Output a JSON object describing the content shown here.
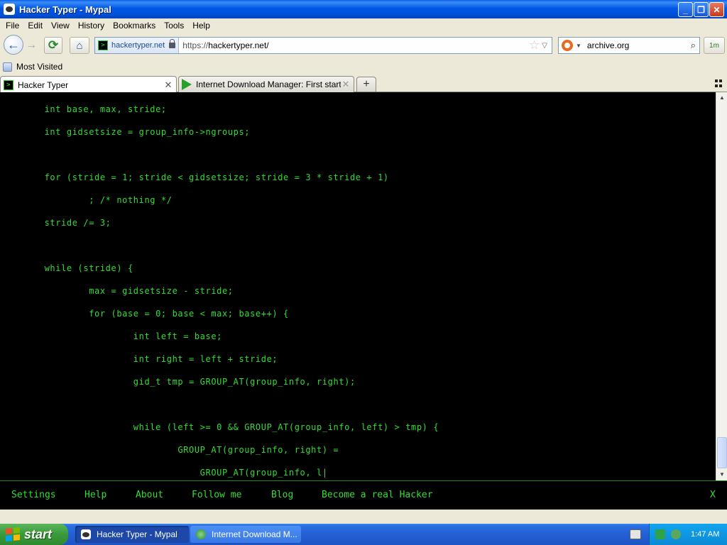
{
  "window": {
    "title": "Hacker Typer - Mypal",
    "controls": {
      "minimize": "_",
      "maximize": "❐",
      "close": "✕"
    }
  },
  "menubar": {
    "items": [
      {
        "label": "File"
      },
      {
        "label": "Edit"
      },
      {
        "label": "View"
      },
      {
        "label": "History"
      },
      {
        "label": "Bookmarks"
      },
      {
        "label": "Tools"
      },
      {
        "label": "Help"
      }
    ]
  },
  "navbar": {
    "back_icon": "←",
    "forward_icon": "→",
    "reload_icon": "⟳",
    "home_icon": "⌂",
    "site_identity": "hackertyper.net",
    "url_scheme": "https://",
    "url_rest": "hackertyper.net/",
    "bookmark_star": "☆",
    "dropdown_arrow": "▽",
    "search_value": "archive.org",
    "search_go_icon": "⌕",
    "idm_label": "1m"
  },
  "bookmarks": {
    "most_visited": "Most Visited"
  },
  "tabs": [
    {
      "label": "Hacker Typer",
      "close": "✕",
      "active": true
    },
    {
      "label": "Internet Download Manager: First start",
      "close": "✕",
      "active": false
    }
  ],
  "new_tab": "+",
  "code_lines": [
    "        int base, max, stride;",
    "        int gidsetsize = group_info->ngroups;",
    "",
    "        for (stride = 1; stride < gidsetsize; stride = 3 * stride + 1)",
    "                ; /* nothing */",
    "        stride /= 3;",
    "",
    "        while (stride) {",
    "                max = gidsetsize - stride;",
    "                for (base = 0; base < max; base++) {",
    "                        int left = base;",
    "                        int right = left + stride;",
    "                        gid_t tmp = GROUP_AT(group_info, right);",
    "",
    "                        while (left >= 0 && GROUP_AT(group_info, left) > tmp) {",
    "                                GROUP_AT(group_info, right) =",
    "                                    GROUP_AT(group_info, l|"
  ],
  "footer": {
    "settings": "Settings",
    "help": "Help",
    "about": "About",
    "follow_me": "Follow me",
    "blog": "Blog",
    "become_hacker": "Become a real Hacker",
    "close": "X"
  },
  "scrollbar": {
    "up": "▲",
    "down": "▼"
  },
  "taskbar": {
    "start_label": "start",
    "tasks": [
      {
        "label": "Hacker Typer - Mypal"
      },
      {
        "label": "Internet Download M..."
      }
    ],
    "clock": "1:47 AM"
  },
  "colors": {
    "terminal_green": "#33dd33",
    "terminal_bg": "#000000",
    "xp_blue": "#0058E6",
    "start_green": "#3a9a3a",
    "windows_flag": [
      "#f25022",
      "#7fba00",
      "#00a4ef",
      "#ffb900"
    ]
  }
}
